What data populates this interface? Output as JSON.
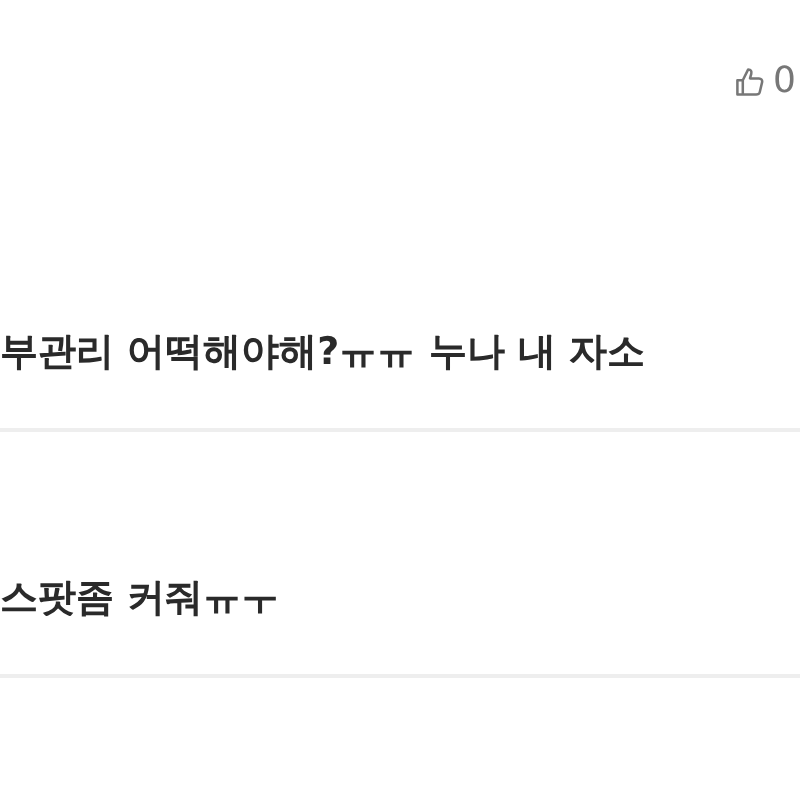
{
  "comment": {
    "likes": "0"
  },
  "replies": [
    {
      "text": "부관리 어떡해야해?ㅠㅠ 누나 내 자소"
    },
    {
      "text": "스팟좀 커줘ㅠㅜ"
    }
  ]
}
